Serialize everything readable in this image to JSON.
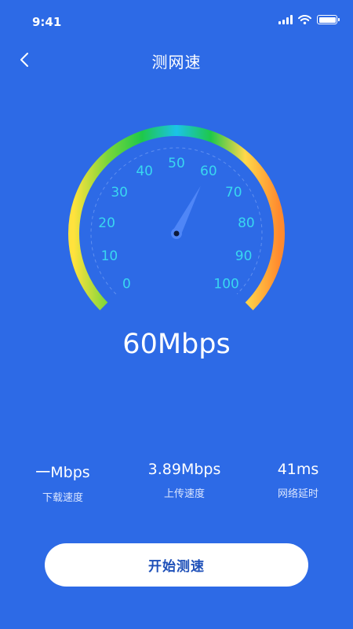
{
  "status_bar": {
    "time": "9:41"
  },
  "header": {
    "title": "测网速"
  },
  "gauge": {
    "min": 0,
    "max": 100,
    "value": 60,
    "tick_labels": [
      "0",
      "10",
      "20",
      "30",
      "40",
      "50",
      "60",
      "70",
      "80",
      "90",
      "100"
    ],
    "gradient_colors": [
      "#ffe23d",
      "#79d63a",
      "#1ec84a",
      "#1bc3e8",
      "#1ec84a",
      "#ffd84a",
      "#ff8a2e"
    ],
    "tick_label_color": "#39d7f0",
    "needle_color": "#4f86f7"
  },
  "speed": {
    "display": "60Mbps"
  },
  "stats": {
    "download": {
      "value": "一Mbps",
      "label": "下载速度"
    },
    "upload": {
      "value": "3.89Mbps",
      "label": "上传速度"
    },
    "latency": {
      "value": "41ms",
      "label": "网络延时"
    }
  },
  "actions": {
    "start_label": "开始测速"
  }
}
